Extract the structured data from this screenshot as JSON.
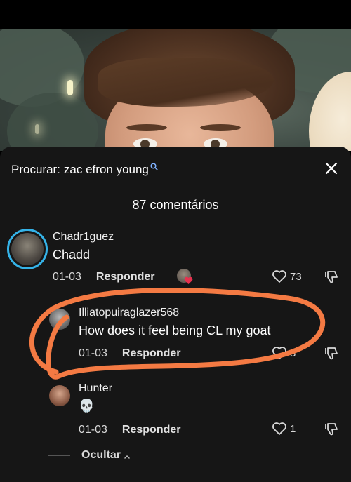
{
  "search": {
    "prefix": "Procurar:",
    "query": "zac efron young"
  },
  "comments_count": "87 comentários",
  "comments": [
    {
      "username": "Chadr1guez",
      "text": "Chadd",
      "date": "01-03",
      "reply_label": "Responder",
      "likes": "73"
    },
    {
      "username": "Illiatopuiraglazer568",
      "text": "How does it feel being CL my goat",
      "date": "01-03",
      "reply_label": "Responder",
      "likes": "3"
    },
    {
      "username": "Hunter",
      "text": "💀",
      "date": "01-03",
      "reply_label": "Responder",
      "likes": "1"
    }
  ],
  "hide_label": "Ocultar",
  "colors": {
    "sheet_bg": "#161616",
    "annotation": "#f47a43",
    "avatar_ring": "#35b3e8",
    "heart_badge": "#e8314f"
  }
}
